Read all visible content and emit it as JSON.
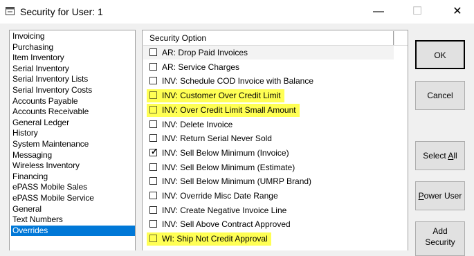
{
  "window": {
    "title": "Security for User: 1",
    "minimize_glyph": "—",
    "maximize_glyph": "☐",
    "close_glyph": "✕"
  },
  "categories": [
    "Invoicing",
    "Purchasing",
    "Item Inventory",
    "Serial Inventory",
    "Serial Inventory Lists",
    "Serial Inventory Costs",
    "Accounts Payable",
    "Accounts Receivable",
    "General Ledger",
    "History",
    "System Maintenance",
    "Messaging",
    "Wireless Inventory",
    "Financing",
    "ePASS Mobile Sales",
    "ePASS Mobile Service",
    "General",
    "Text Numbers",
    "Overrides"
  ],
  "selected_category": "Overrides",
  "grid": {
    "header": "Security Option",
    "rows": [
      {
        "label": "AR: Drop Paid Invoices",
        "checked": false,
        "highlighted": false
      },
      {
        "label": "AR: Service Charges",
        "checked": false,
        "highlighted": false
      },
      {
        "label": "INV: Schedule COD Invoice with Balance",
        "checked": false,
        "highlighted": false
      },
      {
        "label": "INV: Customer Over Credit Limit",
        "checked": false,
        "highlighted": true
      },
      {
        "label": "INV: Over Credit Limit Small Amount",
        "checked": false,
        "highlighted": true
      },
      {
        "label": "INV: Delete Invoice",
        "checked": false,
        "highlighted": false
      },
      {
        "label": "INV: Return Serial Never Sold",
        "checked": false,
        "highlighted": false
      },
      {
        "label": "INV: Sell Below Minimum (Invoice)",
        "checked": true,
        "highlighted": false
      },
      {
        "label": "INV: Sell Below Minimum (Estimate)",
        "checked": false,
        "highlighted": false
      },
      {
        "label": "INV: Sell Below Minimum (UMRP Brand)",
        "checked": false,
        "highlighted": false
      },
      {
        "label": "INV: Override Misc Date Range",
        "checked": false,
        "highlighted": false
      },
      {
        "label": "INV: Create Negative Invoice Line",
        "checked": false,
        "highlighted": false
      },
      {
        "label": "INV: Sell Above Contract Approved",
        "checked": false,
        "highlighted": false
      },
      {
        "label": "WI: Ship Not Credit Approval",
        "checked": false,
        "highlighted": true
      }
    ]
  },
  "buttons": {
    "ok": "OK",
    "cancel": "Cancel",
    "select_all_a": "Select ",
    "select_all_b": "A",
    "select_all_c": "ll",
    "power_user_a": "P",
    "power_user_b": "ower User",
    "add_security_line1": "Add",
    "add_security_line2": "Security"
  },
  "colors": {
    "highlight": "#ffff54",
    "selection": "#0078d7"
  }
}
